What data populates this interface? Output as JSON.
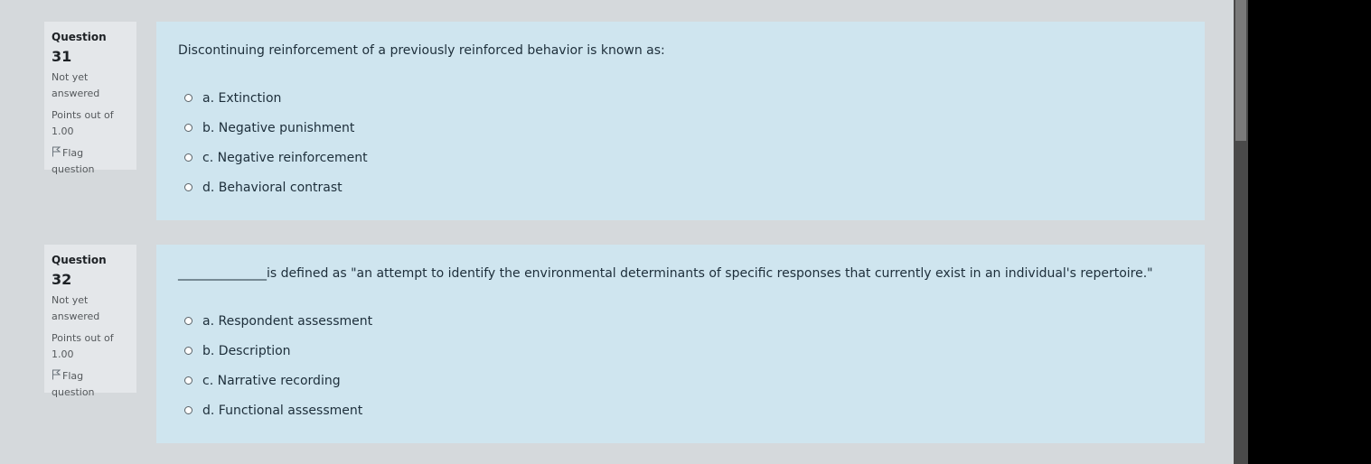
{
  "questions": [
    {
      "label": "Question",
      "number": "31",
      "state": "Not yet answered",
      "grade": "Points out of 1.00",
      "flag_label": "Flag question",
      "blank": "",
      "text": "Discontinuing reinforcement of a previously reinforced behavior is known as:",
      "answers": [
        {
          "label": "a. Extinction"
        },
        {
          "label": "b. Negative punishment"
        },
        {
          "label": "c. Negative reinforcement"
        },
        {
          "label": "d. Behavioral contrast"
        }
      ]
    },
    {
      "label": "Question",
      "number": "32",
      "state": "Not yet answered",
      "grade": "Points out of 1.00",
      "flag_label": "Flag question",
      "blank": "______________",
      "text": "is defined as \"an attempt to identify the environmental determinants of specific responses that currently exist in an individual's repertoire.\"",
      "answers": [
        {
          "label": "a. Respondent assessment"
        },
        {
          "label": "b. Description"
        },
        {
          "label": "c. Narrative recording"
        },
        {
          "label": "d. Functional assessment"
        }
      ]
    }
  ],
  "colors": {
    "page_bg": "#d5d9dc",
    "info_bg": "#e4e7ea",
    "content_bg": "#cfe5ef",
    "scrollbar": "#4a4a4a"
  },
  "icons": {
    "flag": "flag-icon",
    "radio": "radio-unselected-icon"
  }
}
